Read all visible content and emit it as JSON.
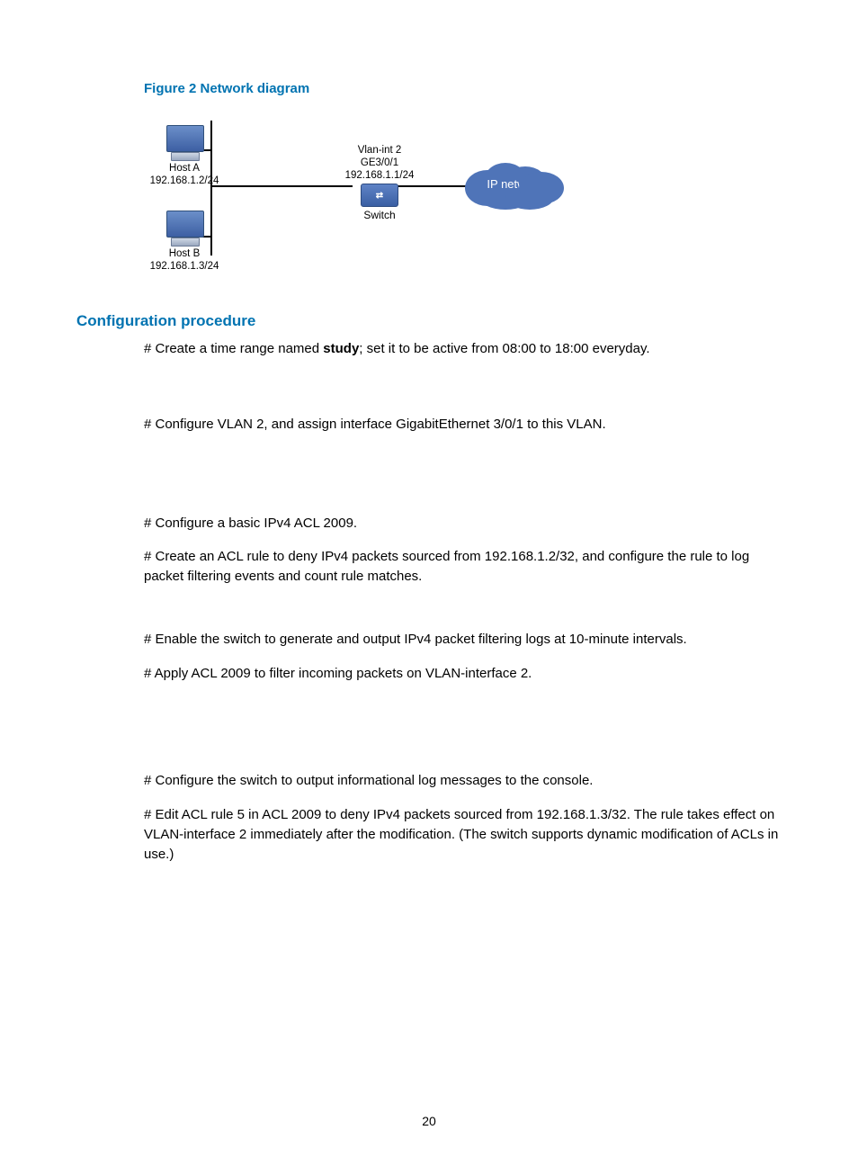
{
  "figure": {
    "title": "Figure 2 Network diagram",
    "hostA": {
      "name": "Host A",
      "ip": "192.168.1.2/24"
    },
    "hostB": {
      "name": "Host B",
      "ip": "192.168.1.3/24"
    },
    "switch": {
      "if_name": "Vlan-int 2",
      "port": "GE3/0/1",
      "ip": "192.168.1.1/24",
      "label": "Switch"
    },
    "cloud": {
      "label": "IP network"
    }
  },
  "section_heading": "Configuration procedure",
  "steps": {
    "s1a": "# Create a time range named ",
    "s1_bold": "study",
    "s1b": "; set it to be active from 08:00 to 18:00 everyday.",
    "s2": "# Configure VLAN 2, and assign interface GigabitEthernet 3/0/1 to this VLAN.",
    "s3": "# Configure a basic IPv4 ACL 2009.",
    "s4": "# Create an ACL rule to deny IPv4 packets sourced from 192.168.1.2/32, and configure the rule to log packet filtering events and count rule matches.",
    "s5": "# Enable the switch to generate and output IPv4 packet filtering logs at 10-minute intervals.",
    "s6": "# Apply ACL 2009 to filter incoming packets on VLAN-interface 2.",
    "s7": "# Configure the switch to output informational log messages to the console.",
    "s8": "# Edit ACL rule 5 in ACL 2009 to deny IPv4 packets sourced from 192.168.1.3/32. The rule takes effect on VLAN-interface 2 immediately after the modification. (The switch supports dynamic modification of ACLs in use.)"
  },
  "page_number": "20"
}
